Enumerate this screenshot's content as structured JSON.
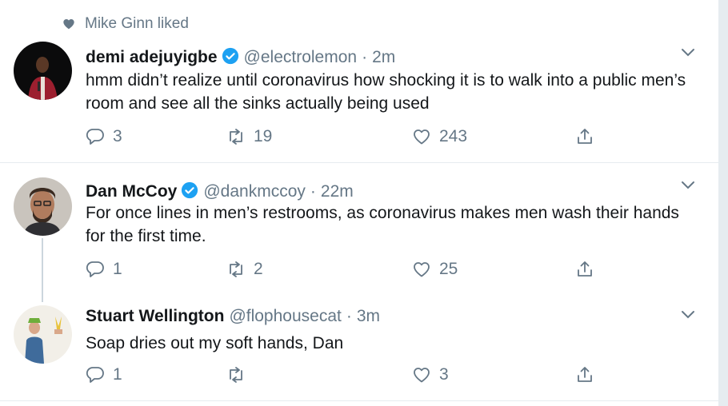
{
  "social_context": {
    "text": "Mike Ginn liked",
    "icon": "heart-icon"
  },
  "tweets": [
    {
      "name": "demi adejuyigbe",
      "verified": true,
      "handle": "@electrolemon",
      "separator": "·",
      "time": "2m",
      "text": "hmm didn’t realize until coronavirus how shocking it is to walk into a public men’s room and see all the sinks actually being used",
      "replies": "3",
      "retweets": "19",
      "likes": "243"
    },
    {
      "name": "Dan McCoy",
      "verified": true,
      "handle": "@dankmccoy",
      "separator": "·",
      "time": "22m",
      "text": "For once lines in men’s restrooms, as coronavirus makes men wash their hands for the first time.",
      "replies": "1",
      "retweets": "2",
      "likes": "25"
    },
    {
      "name": "Stuart Wellington",
      "verified": false,
      "handle": "@flophousecat",
      "separator": "·",
      "time": "3m",
      "text": "Soap dries out my soft hands, Dan",
      "replies": "1",
      "retweets": "",
      "likes": "3"
    }
  ],
  "colors": {
    "text_primary": "#14171a",
    "text_secondary": "#657786",
    "verified_blue": "#1da1f2",
    "divider": "#e6ecf0",
    "thread_line": "#ccd6dd"
  }
}
